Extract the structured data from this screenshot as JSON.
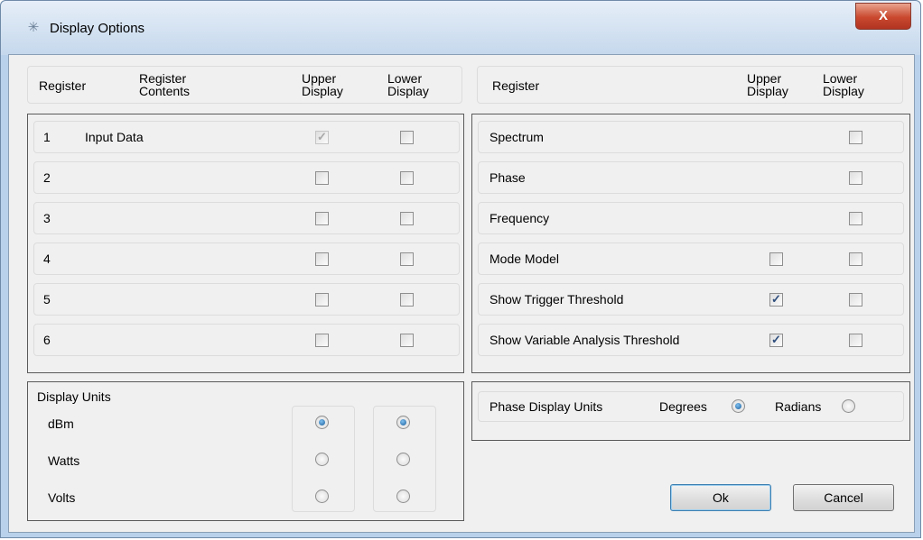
{
  "window": {
    "title": "Display Options",
    "close_glyph": "X"
  },
  "left_header": {
    "register": "Register",
    "contents": "Register\nContents",
    "upper": "Upper\nDisplay",
    "lower": "Lower\nDisplay"
  },
  "right_header": {
    "register": "Register",
    "upper": "Upper\nDisplay",
    "lower": "Lower\nDisplay"
  },
  "left_registers": [
    {
      "num": "1",
      "contents": "Input Data",
      "upper_checked": true,
      "upper_disabled": true,
      "lower_checked": false
    },
    {
      "num": "2",
      "contents": "",
      "upper_checked": false,
      "upper_disabled": false,
      "lower_checked": false
    },
    {
      "num": "3",
      "contents": "",
      "upper_checked": false,
      "upper_disabled": false,
      "lower_checked": false
    },
    {
      "num": "4",
      "contents": "",
      "upper_checked": false,
      "upper_disabled": false,
      "lower_checked": false
    },
    {
      "num": "5",
      "contents": "",
      "upper_checked": false,
      "upper_disabled": false,
      "lower_checked": false
    },
    {
      "num": "6",
      "contents": "",
      "upper_checked": false,
      "upper_disabled": false,
      "lower_checked": false
    }
  ],
  "right_registers": [
    {
      "label": "Spectrum",
      "has_upper": false,
      "upper_checked": false,
      "lower_checked": false
    },
    {
      "label": "Phase",
      "has_upper": false,
      "upper_checked": false,
      "lower_checked": false
    },
    {
      "label": "Frequency",
      "has_upper": false,
      "upper_checked": false,
      "lower_checked": false
    },
    {
      "label": "Modе Model",
      "has_upper": true,
      "upper_checked": false,
      "lower_checked": false
    },
    {
      "label": "Show Trigger Threshold",
      "has_upper": true,
      "upper_checked": true,
      "lower_checked": false
    },
    {
      "label": "Show Variable Analysis Threshold",
      "has_upper": true,
      "upper_checked": true,
      "lower_checked": false
    }
  ],
  "display_units": {
    "title": "Display Units",
    "options": [
      "dBm",
      "Watts",
      "Volts"
    ],
    "upper_selected": "dBm",
    "lower_selected": "dBm"
  },
  "phase_units": {
    "label": "Phase Display Units",
    "degrees": "Degrees",
    "radians": "Radians",
    "selected": "Degrees"
  },
  "buttons": {
    "ok": "Ok",
    "cancel": "Cancel"
  },
  "colors": {
    "frame": "#b9d1ea",
    "client": "#f0f0f0",
    "close": "#c9482e",
    "radio_dot": "#1a5e9a"
  }
}
